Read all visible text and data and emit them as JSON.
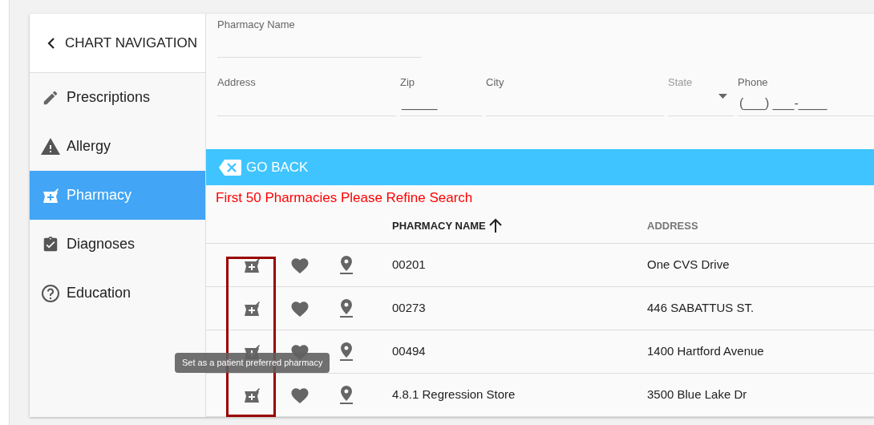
{
  "sidebar": {
    "title": "CHART NAVIGATION",
    "items": [
      {
        "label": "Prescriptions",
        "kind": "pencil",
        "selected": false
      },
      {
        "label": "Allergy",
        "kind": "warning",
        "selected": false
      },
      {
        "label": "Pharmacy",
        "kind": "pharmacy",
        "selected": true
      },
      {
        "label": "Diagnoses",
        "kind": "clipboard",
        "selected": false
      },
      {
        "label": "Education",
        "kind": "help",
        "selected": false
      }
    ]
  },
  "search_form": {
    "pharmacy_name": {
      "label": "Pharmacy Name"
    },
    "address": {
      "label": "Address"
    },
    "zip": {
      "label": "Zip",
      "placeholder": "_____"
    },
    "city": {
      "label": "City"
    },
    "state": {
      "label": "State"
    },
    "phone": {
      "label": "Phone",
      "placeholder": "(___) ___-____"
    }
  },
  "go_back_button": {
    "label": "GO BACK"
  },
  "notice": "First 50 Pharmacies Please Refine Search",
  "table": {
    "columns": [
      {
        "label": "PHARMACY NAME",
        "sorted": true
      },
      {
        "label": "ADDRESS",
        "sorted": false
      }
    ],
    "rows": [
      {
        "name": "00201",
        "address": "One CVS Drive"
      },
      {
        "name": "00273",
        "address": "446 SABATTUS ST."
      },
      {
        "name": "00494",
        "address": "1400 Hartford Avenue"
      },
      {
        "name": "4.8.1 Regression Store",
        "address": "3500 Blue Lake Dr"
      }
    ]
  },
  "tooltip": "Set as a patient preferred pharmacy"
}
